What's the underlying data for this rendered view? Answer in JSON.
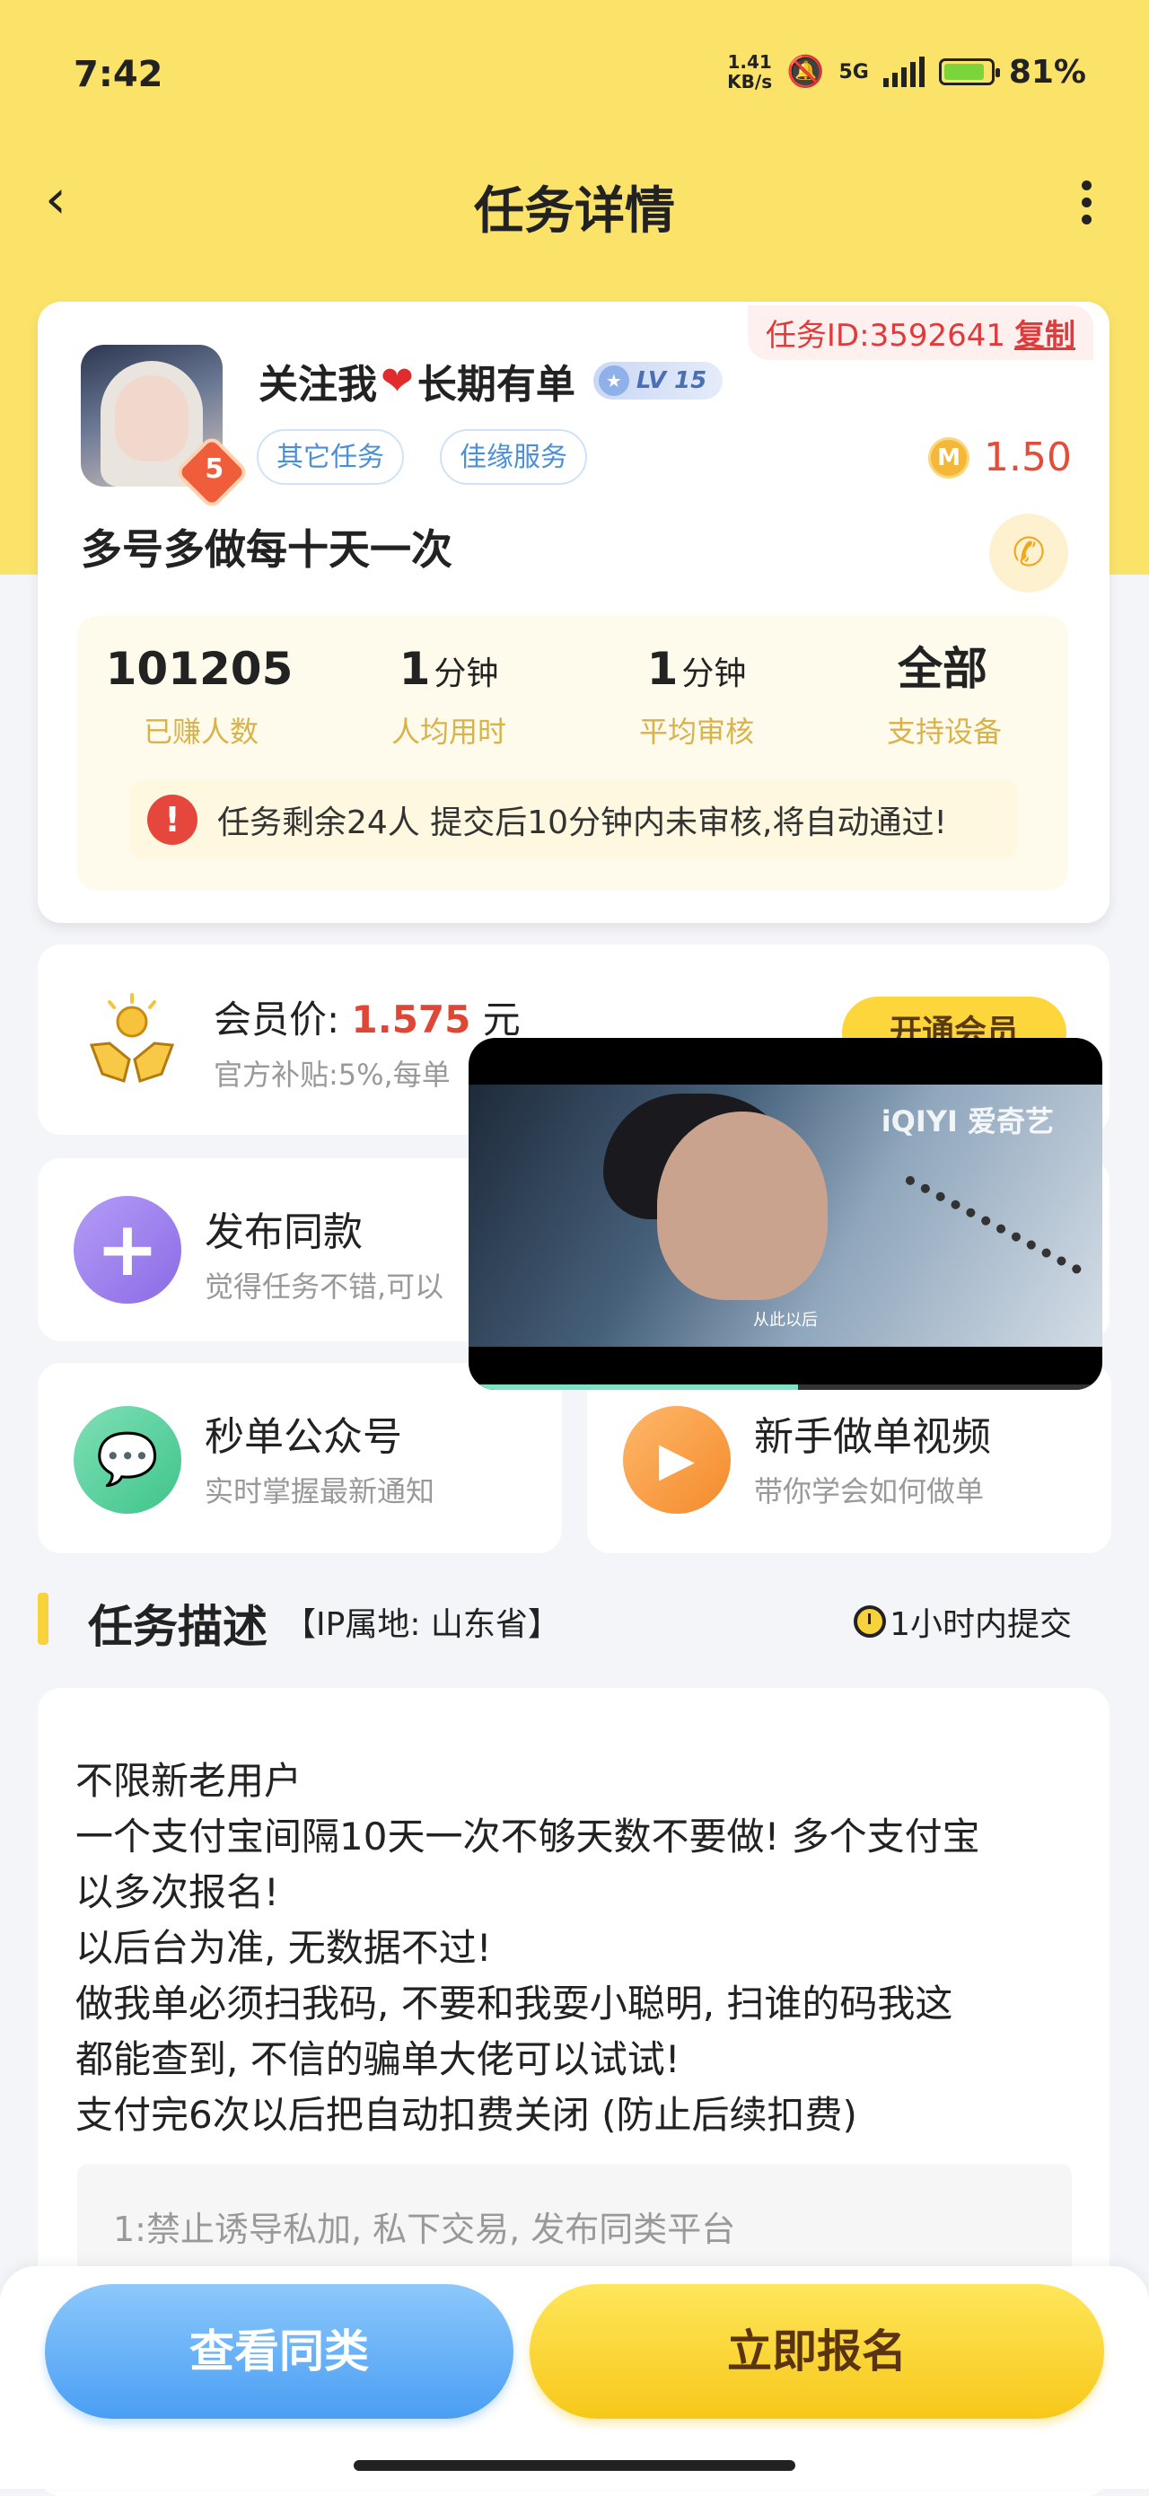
{
  "status_bar": {
    "time": "7:42",
    "net_speed_value": "1.41",
    "net_speed_unit": "KB/s",
    "network": "5G",
    "battery": "81%"
  },
  "nav": {
    "title": "任务详情"
  },
  "task": {
    "id_label": "任务ID:3592641",
    "copy_label": "复制",
    "nickname_a": "关注我",
    "nickname_b": "长期有单",
    "level": "LV 15",
    "avatar_badge": "5",
    "tags": [
      "其它任务",
      "佳缘服务"
    ],
    "price": "1.50",
    "coin_letter": "M",
    "title": "多号多做每十天一次",
    "stats": [
      {
        "value": "101205",
        "unit": "",
        "label": "已赚人数"
      },
      {
        "value": "1",
        "unit": "分钟",
        "label": "人均用时"
      },
      {
        "value": "1",
        "unit": "分钟",
        "label": "平均审核"
      },
      {
        "value": "全部",
        "unit": "",
        "label": "支持设备"
      }
    ],
    "notice": "任务剩余24人  提交后10分钟内未审核,将自动通过!"
  },
  "member": {
    "label": "会员价:",
    "price": "1.575",
    "unit": "元",
    "sub": "官方补贴:5%,每单",
    "button": "开通会员"
  },
  "publish": {
    "title": "发布同款",
    "sub": "觉得任务不错,可以"
  },
  "wechat": {
    "title": "秒单公众号",
    "sub": "实时掌握最新通知"
  },
  "video_tutorial": {
    "title": "新手做单视频",
    "sub": "带你学会如何做单"
  },
  "description": {
    "heading": "任务描述",
    "ip": "【IP属地: 山东省】",
    "deadline": "1小时内提交",
    "lines": [
      "不限新老用户",
      "一个支付宝间隔10天一次不够天数不要做! 多个支付宝",
      "以多次报名!",
      "以后台为准, 无数据不过!",
      "做我单必须扫我码, 不要和我耍小聪明, 扫谁的码我这",
      "都能查到, 不信的骗单大佬可以试试!",
      "支付完6次以后把自动扣费关闭 (防止后续扣费)"
    ],
    "rule": "1:禁止诱导私加, 私下交易, 发布同类平台"
  },
  "bottom": {
    "similar": "查看同类",
    "apply": "立即报名"
  },
  "pip": {
    "logo": "iQIYI 爱奇艺",
    "subtitle": "从此以后",
    "progress": 0.52
  },
  "colors": {
    "brand_yellow": "#fbe36a",
    "price_red": "#e44d3a",
    "accent_blue": "#4a9ef4"
  }
}
